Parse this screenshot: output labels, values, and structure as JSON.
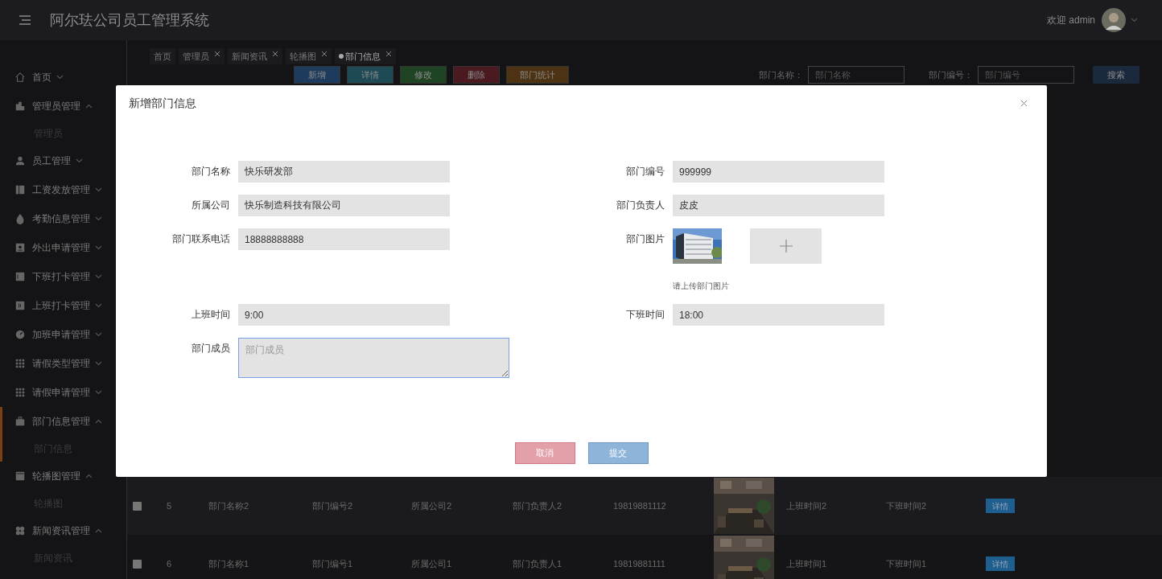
{
  "header": {
    "title": "阿尔珐公司员工管理系统",
    "welcome": "欢迎 admin"
  },
  "sidebar": {
    "items": [
      {
        "label": "首页",
        "expanded": false,
        "selected": false
      },
      {
        "label": "管理员管理",
        "expanded": true,
        "selected": false,
        "children": [
          {
            "label": "管理员"
          }
        ]
      },
      {
        "label": "员工管理",
        "expanded": false,
        "selected": false
      },
      {
        "label": "工资发放管理",
        "expanded": false,
        "selected": false
      },
      {
        "label": "考勤信息管理",
        "expanded": false,
        "selected": false
      },
      {
        "label": "外出申请管理",
        "expanded": false,
        "selected": false
      },
      {
        "label": "下班打卡管理",
        "expanded": false,
        "selected": false
      },
      {
        "label": "上班打卡管理",
        "expanded": false,
        "selected": false
      },
      {
        "label": "加班申请管理",
        "expanded": false,
        "selected": false
      },
      {
        "label": "请假类型管理",
        "expanded": false,
        "selected": false
      },
      {
        "label": "请假申请管理",
        "expanded": false,
        "selected": false
      },
      {
        "label": "部门信息管理",
        "expanded": true,
        "selected": true,
        "children": [
          {
            "label": "部门信息"
          }
        ]
      },
      {
        "label": "轮播图管理",
        "expanded": true,
        "selected": false,
        "children": [
          {
            "label": "轮播图"
          }
        ]
      },
      {
        "label": "新闻资讯管理",
        "expanded": true,
        "selected": false,
        "children": [
          {
            "label": "新闻资讯"
          }
        ]
      }
    ]
  },
  "tabs": [
    {
      "label": "首页",
      "closable": false,
      "selected": false
    },
    {
      "label": "管理员",
      "closable": true,
      "selected": false
    },
    {
      "label": "新闻资讯",
      "closable": true,
      "selected": false
    },
    {
      "label": "轮播图",
      "closable": true,
      "selected": false
    },
    {
      "label": "部门信息",
      "closable": true,
      "selected": true
    }
  ],
  "toolbar": {
    "buttons": [
      {
        "label": "新增",
        "color": "#1d3b5c"
      },
      {
        "label": "详情",
        "color": "#1d4a55"
      },
      {
        "label": "修改",
        "color": "#1f4424"
      },
      {
        "label": "删除",
        "color": "#4a1a20"
      },
      {
        "label": "部门统计",
        "color": "#4d3314"
      }
    ]
  },
  "search": {
    "fields": [
      {
        "label": "部门名称：",
        "placeholder": "部门名称"
      },
      {
        "label": "部门编号：",
        "placeholder": "部门编号"
      }
    ],
    "button": "搜索"
  },
  "table": {
    "rows": [
      {
        "checked": false,
        "cells": [
          "5",
          "部门名称2",
          "部门编号2",
          "所属公司2",
          "部门负责人2",
          "19819881112"
        ],
        "times": [
          "上班时间2",
          "下班时间2"
        ],
        "action": "详情"
      },
      {
        "checked": false,
        "cells": [
          "6",
          "部门名称1",
          "部门编号1",
          "所属公司1",
          "部门负责人1",
          "19819881111"
        ],
        "times": [
          "上班时间1",
          "下班时间1"
        ],
        "action": "详情"
      }
    ]
  },
  "modal": {
    "title": "新增部门信息",
    "rows": [
      [
        {
          "kind": "input",
          "label": "部门名称",
          "value": "快乐研发部"
        },
        {
          "kind": "input",
          "label": "部门编号",
          "value": "999999"
        }
      ],
      [
        {
          "kind": "input",
          "label": "所属公司",
          "value": "快乐制造科技有限公司"
        },
        {
          "kind": "input",
          "label": "部门负责人",
          "value": "皮皮"
        }
      ],
      [
        {
          "kind": "input",
          "label": "部门联系电话",
          "value": "18888888888"
        },
        {
          "label": "部门图片",
          "hint": "请上传部门图片"
        }
      ],
      [
        {
          "kind": "input",
          "label": "上班时间",
          "value": "9:00"
        },
        {
          "kind": "input",
          "label": "下班时间",
          "value": "18:00"
        }
      ],
      [
        {
          "kind": "textarea",
          "label": "部门成员",
          "placeholder": "部门成员"
        }
      ]
    ],
    "buttons": [
      {
        "label": "取消",
        "kind": "cancel"
      },
      {
        "label": "提交",
        "kind": "submit"
      }
    ]
  }
}
